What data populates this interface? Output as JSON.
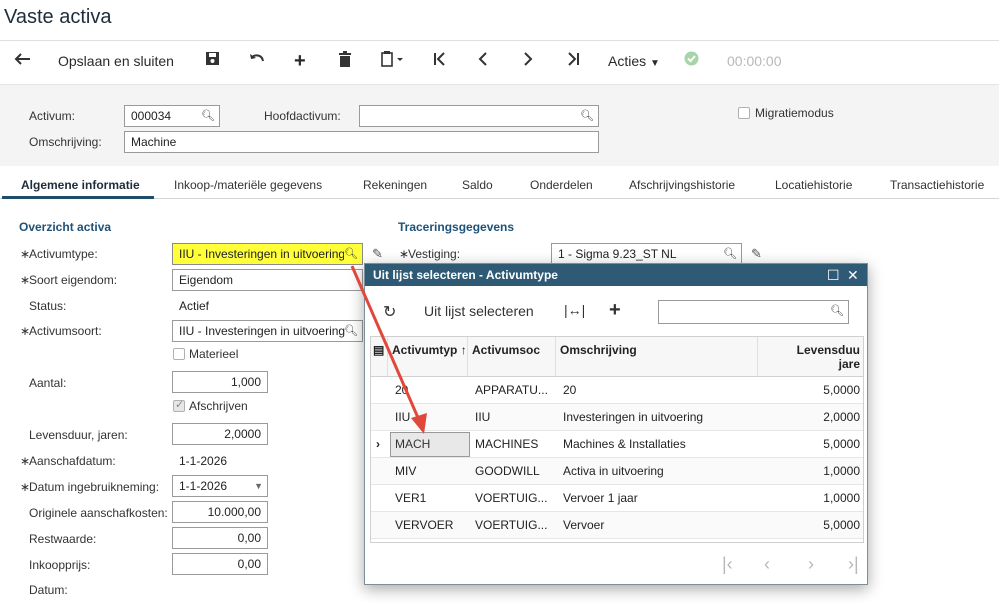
{
  "page": {
    "title": "Vaste activa"
  },
  "toolbar": {
    "save_close_label": "Opslaan en sluiten",
    "actions_label": "Acties",
    "timer": "00:00:00"
  },
  "header": {
    "activum_label": "Activum:",
    "activum_value": "000034",
    "hoofdactivum_label": "Hoofdactivum:",
    "hoofdactivum_value": "",
    "omschrijving_label": "Omschrijving:",
    "omschrijving_value": "Machine",
    "migratiemodus_label": "Migratiemodus"
  },
  "tabs": [
    "Algemene informatie",
    "Inkoop-/materiële gegevens",
    "Rekeningen",
    "Saldo",
    "Onderdelen",
    "Afschrijvingshistorie",
    "Locatiehistorie",
    "Transactiehistorie"
  ],
  "overview": {
    "section_title": "Overzicht activa",
    "activumtype_label": "Activumtype:",
    "activumtype_value": "IIU - Investeringen in uitvoering",
    "soort_label": "Soort eigendom:",
    "soort_value": "Eigendom",
    "status_label": "Status:",
    "status_value": "Actief",
    "activumsoort_label": "Activumsoort:",
    "activumsoort_value": "IIU - Investeringen in uitvoering",
    "materieel_label": "Materieel",
    "aantal_label": "Aantal:",
    "aantal_value": "1,000",
    "afschrijven_label": "Afschrijven",
    "levensduur_label": "Levensduur, jaren:",
    "levensduur_value": "2,0000",
    "aanschafdatum_label": "Aanschafdatum:",
    "aanschafdatum_value": "1-1-2026",
    "ingebruik_label": "Datum ingebruikneming:",
    "ingebruik_value": "1-1-2026",
    "orig_kosten_label": "Originele aanschafkosten:",
    "orig_kosten_value": "10.000,00",
    "restwaarde_label": "Restwaarde:",
    "restwaarde_value": "0,00",
    "inkoopprijs_label": "Inkoopprijs:",
    "inkoopprijs_value": "0,00",
    "datum_label": "Datum:"
  },
  "tracing": {
    "section_title": "Traceringsgegevens",
    "vestiging_label": "Vestiging:",
    "vestiging_value": "1 - Sigma 9.23_ST NL"
  },
  "popup": {
    "title": "Uit lijst selecteren - Activumtype",
    "select_label": "Uit lijst selecteren",
    "search_value": "",
    "columns": [
      "Activumtyp",
      "Activumsoc",
      "Omschrijving",
      "Levensduu",
      "jare"
    ],
    "rows": [
      {
        "code": "20",
        "soort": "APPARATU...",
        "omschrijving": "20",
        "levensduur": "5,0000"
      },
      {
        "code": "IIU",
        "soort": "IIU",
        "omschrijving": "Investeringen in uitvoering",
        "levensduur": "2,0000"
      },
      {
        "code": "MACH",
        "soort": "MACHINES",
        "omschrijving": "Machines & Installaties",
        "levensduur": "5,0000"
      },
      {
        "code": "MIV",
        "soort": "GOODWILL",
        "omschrijving": "Activa in uitvoering",
        "levensduur": "1,0000"
      },
      {
        "code": "VER1",
        "soort": "VOERTUIG...",
        "omschrijving": "Vervoer 1 jaar",
        "levensduur": "1,0000"
      },
      {
        "code": "VERVOER",
        "soort": "VOERTUIG...",
        "omschrijving": "Vervoer",
        "levensduur": "5,0000"
      }
    ]
  },
  "colors": {
    "accent": "#1e4e69",
    "popup_header": "#2e5a76",
    "highlight": "#ffff3a",
    "arrow": "#e0483c"
  }
}
